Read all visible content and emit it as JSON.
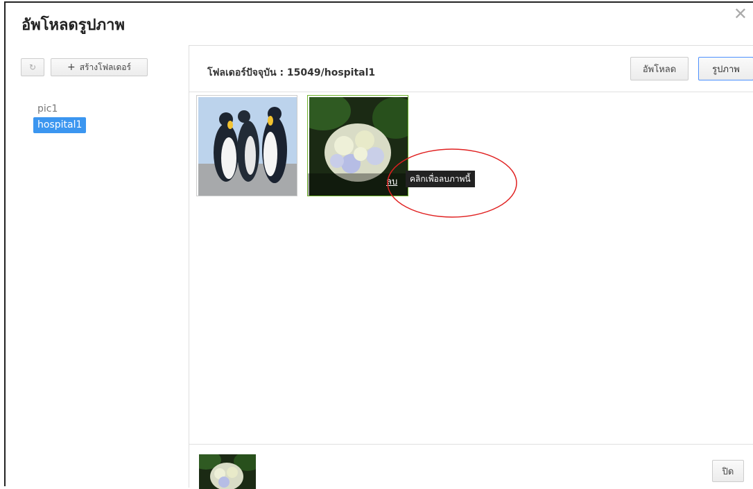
{
  "dialog": {
    "title": "อัพโหลดรูปภาพ",
    "close_icon": "close-icon"
  },
  "sidebar": {
    "refresh_icon": "refresh-icon",
    "new_folder_label": "สร้างโฟลเดอร์",
    "new_folder_plus": "+",
    "folders": [
      {
        "label": "pic1",
        "selected": false
      },
      {
        "label": "hospital1",
        "selected": true
      }
    ]
  },
  "main": {
    "current_folder_label": "โฟลเดอร์ปัจจุบัน : 15049/hospital1",
    "upload_label": "อัพโหลด",
    "images_label": "รูปภาพ",
    "thumbnails": [
      {
        "subject": "penguins"
      },
      {
        "subject": "hydrangea",
        "hovered": true
      }
    ],
    "delete_link": "ลบ",
    "tooltip": "คลิกเพื่อลบภาพนี้"
  },
  "footer": {
    "close_label": "ปิด"
  },
  "colors": {
    "selected": "#3b96f0",
    "annotation": "#e02020",
    "hover_border": "#6fb32a"
  }
}
